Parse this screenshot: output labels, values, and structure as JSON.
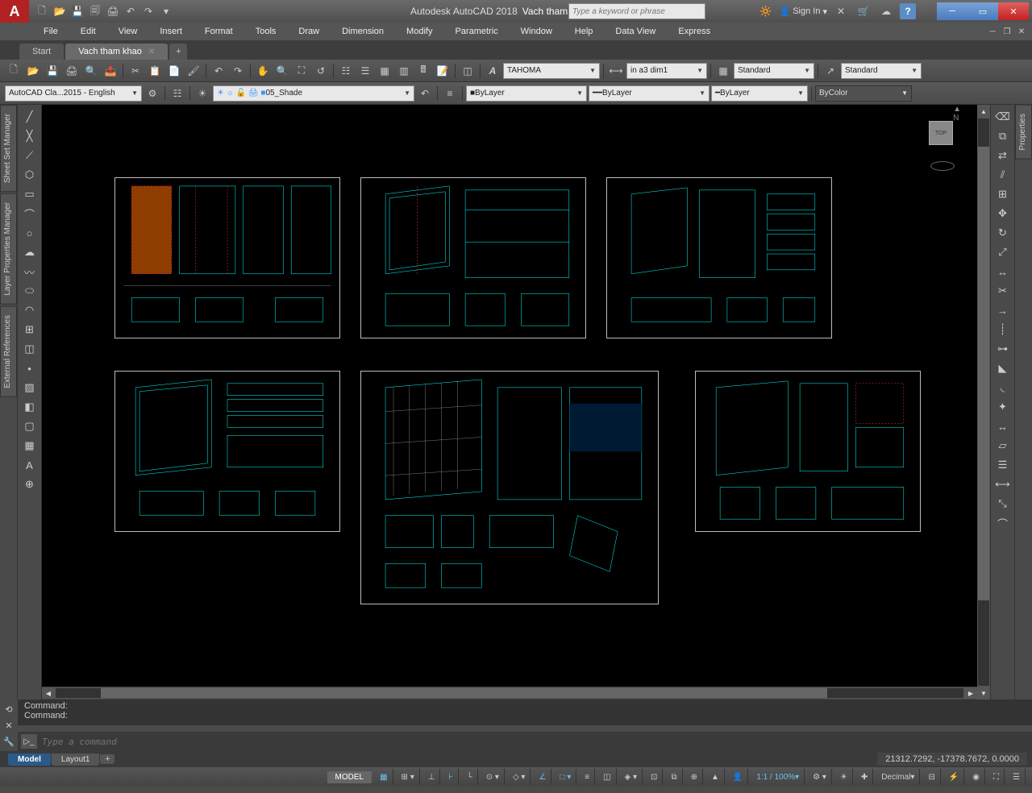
{
  "title": {
    "app": "Autodesk AutoCAD 2018",
    "doc": "Vach tham khao.dwg",
    "dropdown": "▸"
  },
  "search": {
    "placeholder": "Type a keyword or phrase"
  },
  "signin": "Sign In",
  "menu": [
    "File",
    "Edit",
    "View",
    "Insert",
    "Format",
    "Tools",
    "Draw",
    "Dimension",
    "Modify",
    "Parametric",
    "Window",
    "Help",
    "Data View",
    "Express"
  ],
  "tabs": {
    "start": "Start",
    "active": "Vach tham khao"
  },
  "toolbar1": {
    "font": "TAHOMA",
    "dimstyle": "in a3 dim1",
    "tablestyle": "Standard",
    "mlstyle": "Standard"
  },
  "toolbar2": {
    "workspace": "AutoCAD Cla...2015 - English",
    "layer": "05_Shade",
    "linetype": "ByLayer",
    "lineweight": "ByLayer",
    "plotstyle": "ByLayer",
    "color": "ByColor"
  },
  "left_panels": [
    "Sheet Set Manager",
    "Layer Properties Manager",
    "External References"
  ],
  "right_panels": [
    "Properties"
  ],
  "viewcube": {
    "face": "TOP",
    "n": "N"
  },
  "cmd": {
    "line1": "Command:",
    "line2": "Command:",
    "placeholder": "Type a command"
  },
  "layout": {
    "model": "Model",
    "layouts": [
      "Layout1"
    ]
  },
  "coords": "21312.7292, -17378.7672, 0.0000",
  "status": {
    "model": "MODEL",
    "scale": "1:1 / 100%",
    "units": "Decimal"
  }
}
